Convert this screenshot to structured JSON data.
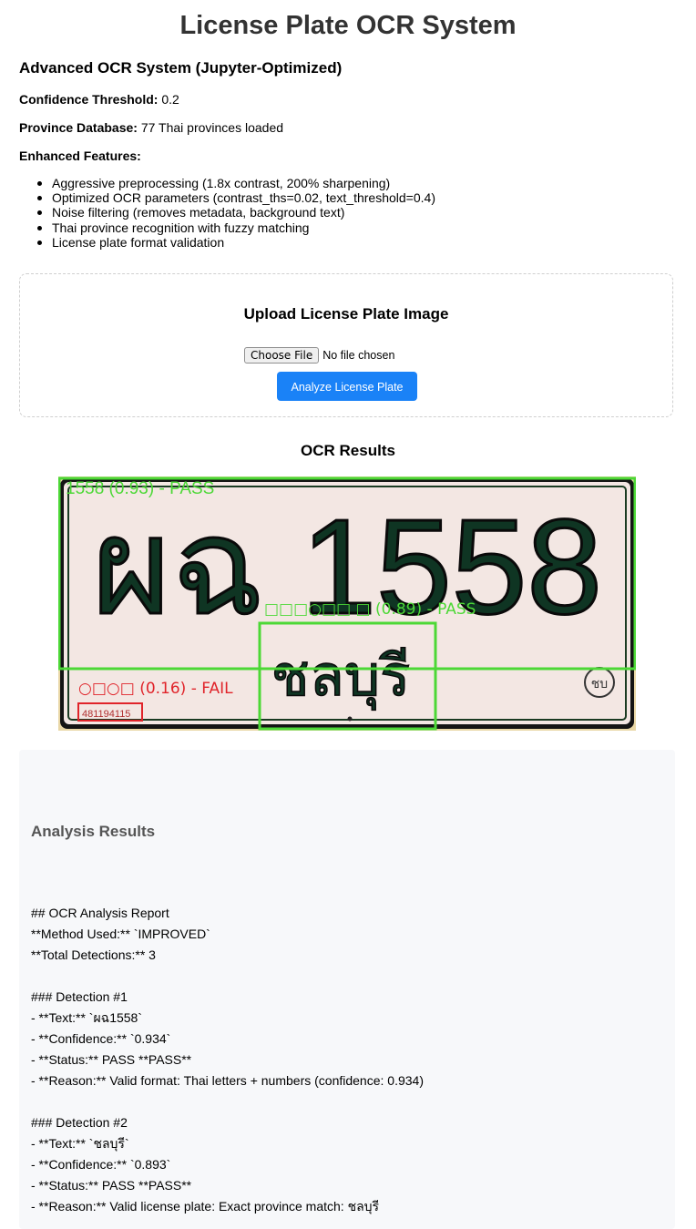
{
  "page": {
    "title": "License Plate OCR System"
  },
  "system": {
    "heading": "Advanced OCR System (Jupyter-Optimized)",
    "confidence_label": "Confidence Threshold:",
    "confidence_value": "0.2",
    "province_label": "Province Database:",
    "province_value": "77 Thai provinces loaded",
    "features_label": "Enhanced Features:",
    "features": [
      "Aggressive preprocessing (1.8x contrast, 200% sharpening)",
      "Optimized OCR parameters (contrast_ths=0.02, text_threshold=0.4)",
      "Noise filtering (removes metadata, background text)",
      "Thai province recognition with fuzzy matching",
      "License plate format validation"
    ]
  },
  "upload": {
    "title": "Upload License Plate Image",
    "choose_file_label": "Choose File",
    "file_status": "No file chosen",
    "analyze_button": "Analyze License Plate"
  },
  "results": {
    "heading": "OCR Results",
    "plate": {
      "main_text": "ผฉ 1558",
      "province_text": "ชลบุรี",
      "serial_text": "481194115",
      "seal_text": "ชบ",
      "detections": [
        {
          "label": "1558 (0.93) - PASS",
          "status": "PASS",
          "color": "#4cd836"
        },
        {
          "label": "□□□○□□ □ (0.89) - PASS",
          "status": "PASS",
          "color": "#4cd836"
        },
        {
          "label": "○□○□ (0.16) - FAIL",
          "status": "FAIL",
          "color": "#e0242a"
        }
      ]
    }
  },
  "analysis": {
    "title": "Analysis Results",
    "report_header": [
      "## OCR Analysis Report",
      "**Method Used:** `IMPROVED`",
      "**Total Detections:** 3"
    ],
    "detections": [
      {
        "heading": "### Detection #1",
        "text_line": "- **Text:** `ผฉ1558`",
        "confidence_line": "- **Confidence:** `0.934`",
        "status_line": "- **Status:** PASS **PASS**",
        "reason_line": "- **Reason:** Valid format: Thai letters + numbers (confidence: 0.934)"
      },
      {
        "heading": "### Detection #2",
        "text_line": "- **Text:** `ชลบุรี`",
        "confidence_line": "- **Confidence:** `0.893`",
        "status_line": "- **Status:** PASS **PASS**",
        "reason_line": "- **Reason:** Valid license plate: Exact province match: ชลบุรี"
      }
    ]
  }
}
